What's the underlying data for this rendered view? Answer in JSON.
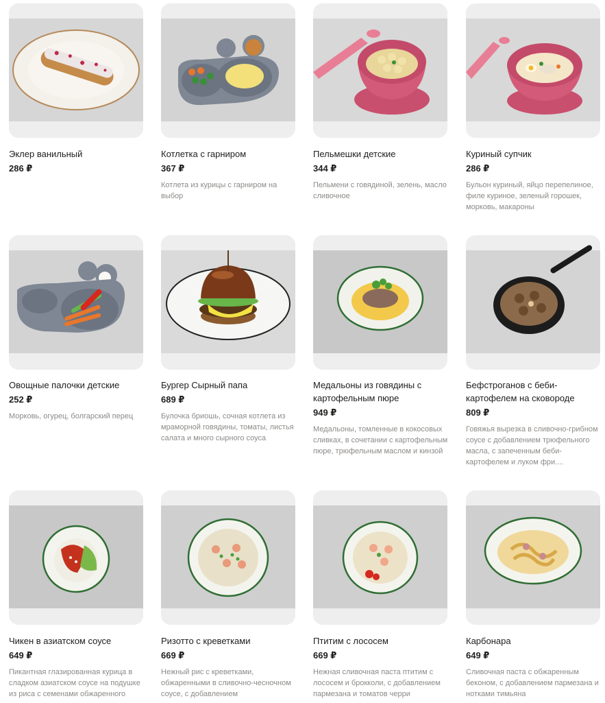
{
  "products": [
    {
      "name": "Эклер ванильный",
      "price": "286 ₽",
      "description": "",
      "image_icon": "eclair-plate-image"
    },
    {
      "name": "Котлетка с гарниром",
      "price": "367 ₽",
      "description": "Котлета из курицы с гарниром на выбор",
      "image_icon": "kids-crab-plate-image"
    },
    {
      "name": "Пельмешки детские",
      "price": "344 ₽",
      "description": "Пельмени с говядиной, зелень, масло сливочное",
      "image_icon": "pink-bowl-dumplings-image"
    },
    {
      "name": "Куриный супчик",
      "price": "286 ₽",
      "description": "Бульон куриный, яйцо перепелиное, филе куриное, зеленый горошек, морковь, макароны",
      "image_icon": "pink-bowl-soup-image"
    },
    {
      "name": "Овощные палочки детские",
      "price": "252 ₽",
      "description": "Морковь, огурец, болгарский перец",
      "image_icon": "kids-crab-plate-vegetables-image"
    },
    {
      "name": "Бургер Сырный папа",
      "price": "689 ₽",
      "description": "Булочка бриошь, сочная котлета из мраморной говядины, томаты, листья салата и много сырного соуса",
      "image_icon": "burger-plate-image"
    },
    {
      "name": "Медальоны из говядины с картофельным пюре",
      "price": "949 ₽",
      "description": "Медальоны, томленные в кокосовых сливках, в сочетании с картофельным пюре, трюфельным маслом и кинзой",
      "image_icon": "beef-medallions-bowl-image"
    },
    {
      "name": "Бефстроганов с беби-картофелем на сковороде",
      "price": "809 ₽",
      "description": "Говяжья вырезка в сливочно-грибном соусе с добавлением трюфельного масла, с запеченным беби-картофелем и луком фри....",
      "image_icon": "skillet-stroganoff-image"
    },
    {
      "name": "Чикен в азиатском соусе",
      "price": "649 ₽",
      "description": "Пикантная глазированная курица в сладком азиатском соусе на подушке из риса с семенами обжаренного",
      "image_icon": "asian-chicken-bowl-image"
    },
    {
      "name": "Ризотто с креветками",
      "price": "669 ₽",
      "description": "Нежный рис с креветками, обжаренными в сливочно-чесночном соусе, с добавлением",
      "image_icon": "risotto-bowl-image"
    },
    {
      "name": "Птитим с лососем",
      "price": "669 ₽",
      "description": "Нежная сливочная паста птитим с лососем и брокколи, с добавлением пармезана и томатов черри",
      "image_icon": "ptitim-bowl-image"
    },
    {
      "name": "Карбонара",
      "price": "649 ₽",
      "description": "Сливочная паста с обжаренным беконом, с добавлением пармезана и нотками тимьяна",
      "image_icon": "carbonara-bowl-image"
    }
  ]
}
